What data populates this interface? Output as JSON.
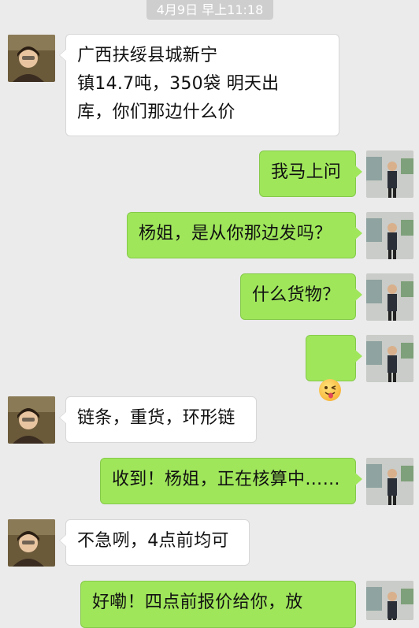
{
  "timestamp": "4月9日 早上11:18",
  "messages": [
    {
      "side": "in",
      "text": "广西扶绥县城新宁\n镇14.7吨，350袋 明天出\n库，你们那边什么价"
    },
    {
      "side": "out",
      "text": "我马上问"
    },
    {
      "side": "out",
      "text": "杨姐，是从你那边发吗？"
    },
    {
      "side": "out",
      "text": "什么货物？"
    },
    {
      "side": "out",
      "emoji": "winking-tongue-emoji"
    },
    {
      "side": "in",
      "text": "链条，重货，环形链"
    },
    {
      "side": "out",
      "text": "收到！杨姐，正在核算中……"
    },
    {
      "side": "in",
      "text": "不急咧，4点前均可"
    },
    {
      "side": "out",
      "text": "好嘞！四点前报价给你，放"
    }
  ],
  "colors": {
    "background": "#ebebeb",
    "incoming_bubble": "#ffffff",
    "outgoing_bubble": "#9fe65b",
    "timestamp_pill": "#cecece"
  }
}
